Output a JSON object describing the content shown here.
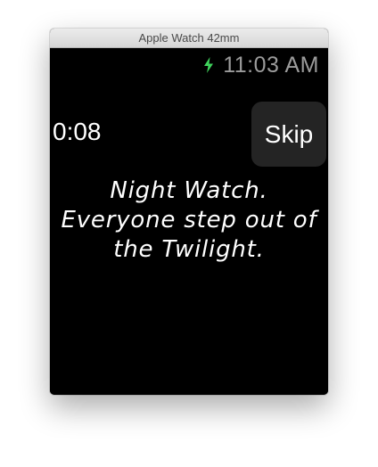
{
  "window": {
    "title": "Apple Watch 42mm"
  },
  "status": {
    "clock": "11:03 AM",
    "charging_icon": "lightning-bolt-icon",
    "charging_color": "#3fd35c"
  },
  "workout": {
    "timer": "0:08",
    "skip_label": "Skip",
    "message": "Night Watch. Everyone step out of the Twilight."
  }
}
